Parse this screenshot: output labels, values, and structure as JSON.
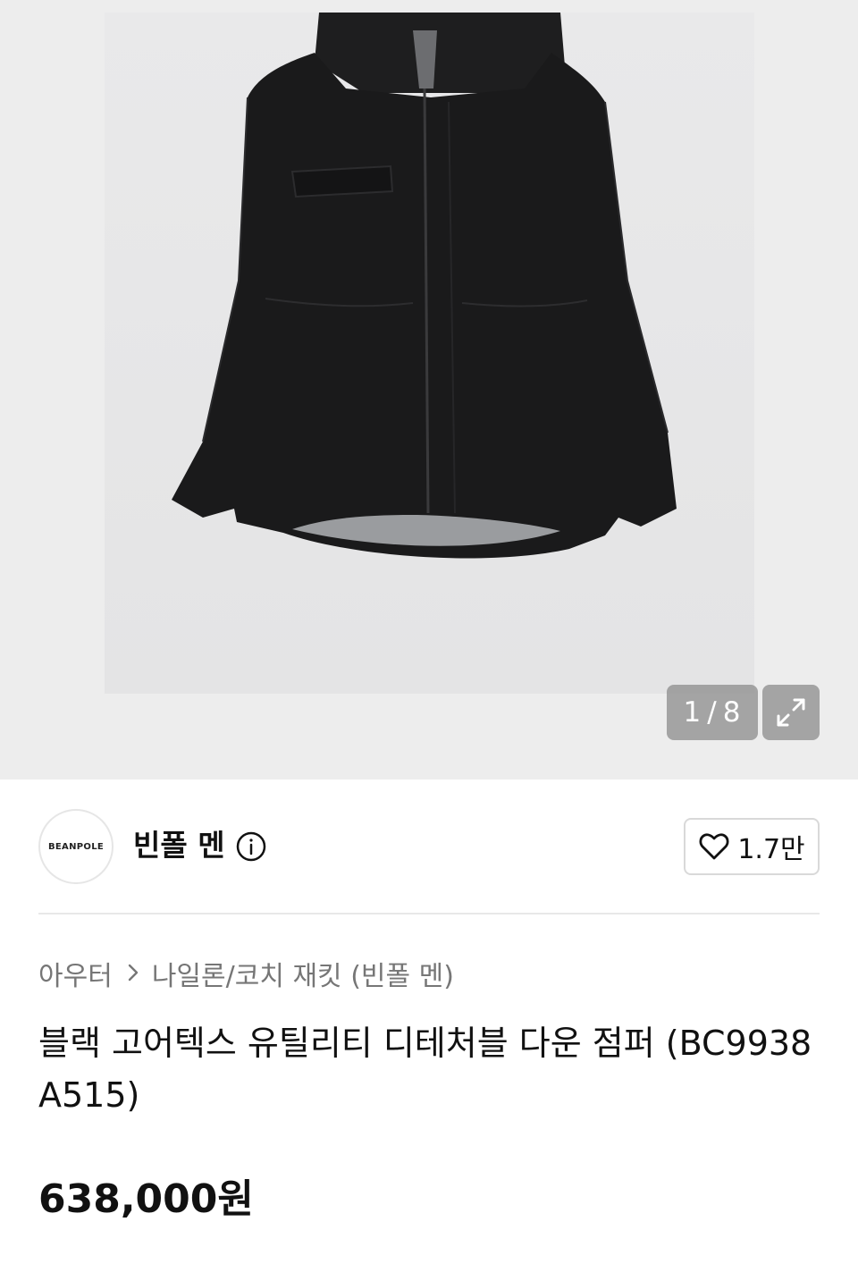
{
  "gallery": {
    "current": "1",
    "separator": "/",
    "total": "8",
    "image_alt": "블랙 고어텍스 유틸리티 디테처블 다운 점퍼"
  },
  "brand": {
    "logo_text": "BEANPOLE",
    "name": "빈폴 멘",
    "likes": "1.7만"
  },
  "breadcrumb": {
    "items": [
      "아우터",
      "나일론/코치 재킷 (빈폴 멘)"
    ]
  },
  "product": {
    "title": "블랙 고어텍스 유틸리티 디테처블 다운 점퍼 (BC9938A515)",
    "price": "638,000원"
  },
  "colors": {
    "overlay": "#969696",
    "text_primary": "#111111",
    "text_secondary": "#767676",
    "border": "#d9d9d9"
  },
  "icons": [
    "expand-icon",
    "info-icon",
    "heart-icon",
    "chevron-right-icon"
  ]
}
